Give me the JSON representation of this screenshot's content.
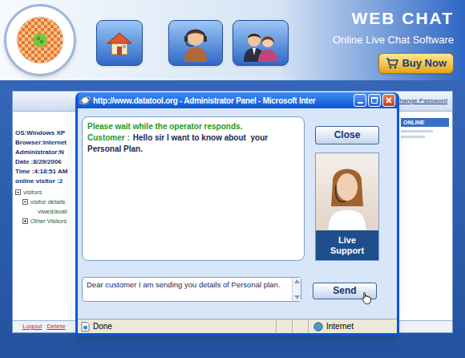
{
  "header": {
    "title": "WEB CHAT",
    "subtitle": "Online Live Chat Software",
    "buy_button": "Buy Now"
  },
  "admin_panel": {
    "change_password": "Change Password",
    "online_label": "ONLINE",
    "info": [
      "OS:Windows XP",
      "Browser:Internet",
      "Administrator:N",
      "Date :8/29/2006",
      "Time :4:18:51 AM",
      "online visitor :2"
    ],
    "tree": [
      {
        "label": "visitors",
        "expanded": true,
        "children": [
          {
            "label": "visitor details",
            "expanded": true,
            "children": [
              {
                "label": "viwed/avail"
              }
            ]
          },
          {
            "label": "Other Visitors",
            "expanded": false
          }
        ]
      }
    ],
    "footer_links": [
      "Logout",
      "Delete"
    ]
  },
  "chat_window": {
    "title": "http://www.datatool.org - Administrator Panel - Microsoft Inter",
    "status_message": "Please wait while the operator responds.",
    "messages": [
      {
        "sender": "Customer :",
        "text": "Hello sir I want to know about  your Personal Plan."
      }
    ],
    "input_value": "Dear customer I am sending you details of Personal plan.",
    "close_button": "Close",
    "live_support": "Live Support",
    "send_button": "Send",
    "status_bar": {
      "left": "Done",
      "right": "Internet"
    }
  }
}
